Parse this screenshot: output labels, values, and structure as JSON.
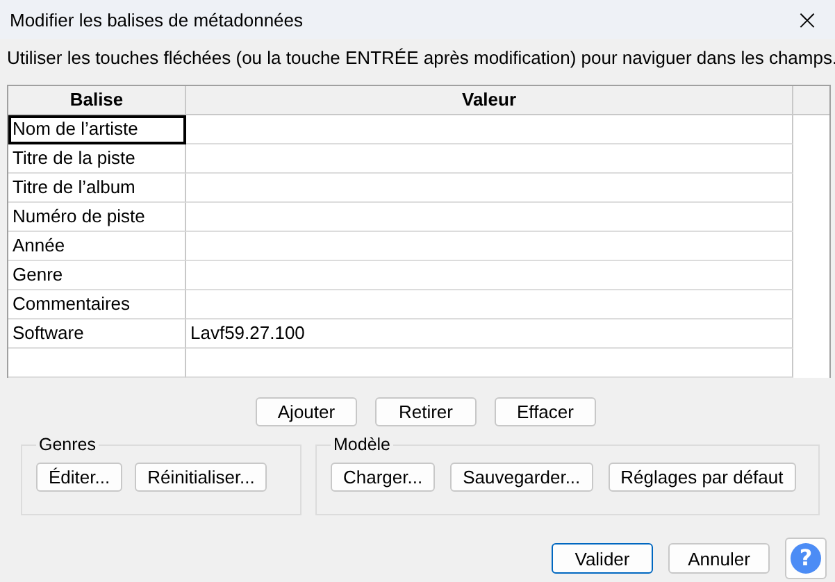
{
  "window": {
    "title": "Modifier les balises de métadonnées",
    "close": "×"
  },
  "instruction": "Utiliser les touches fléchées (ou la touche ENTRÉE après modification) pour naviguer dans les champs.",
  "table": {
    "columns": [
      "Balise",
      "Valeur"
    ],
    "rows": [
      {
        "tag": "Nom de l’artiste",
        "selected": true
      },
      {
        "tag": "Titre de la piste",
        "selected": false
      },
      {
        "tag": "Titre de l’album",
        "selected": false
      },
      {
        "tag": "Numéro de piste",
        "selected": false
      },
      {
        "tag": "Année",
        "selected": false
      },
      {
        "tag": "Genre",
        "selected": false
      },
      {
        "tag": "Commentaires",
        "selected": false
      },
      {
        "tag": "Software",
        "value": "Lavf59.27.100",
        "selected": false
      }
    ]
  },
  "row_buttons": [
    "Ajouter",
    "Retirer",
    "Effacer"
  ],
  "groups": [
    {
      "title": "Genres",
      "buttons": [
        "Éditer...",
        "Réinitialiser..."
      ]
    },
    {
      "title": "Modèle",
      "buttons": [
        "Charger...",
        "Sauvegarder...",
        "Réglages par défaut"
      ]
    }
  ],
  "footer": {
    "buttons": [
      {
        "label": "Valider",
        "default": true
      },
      {
        "label": "Annuler",
        "default": false
      }
    ],
    "help": "?"
  }
}
